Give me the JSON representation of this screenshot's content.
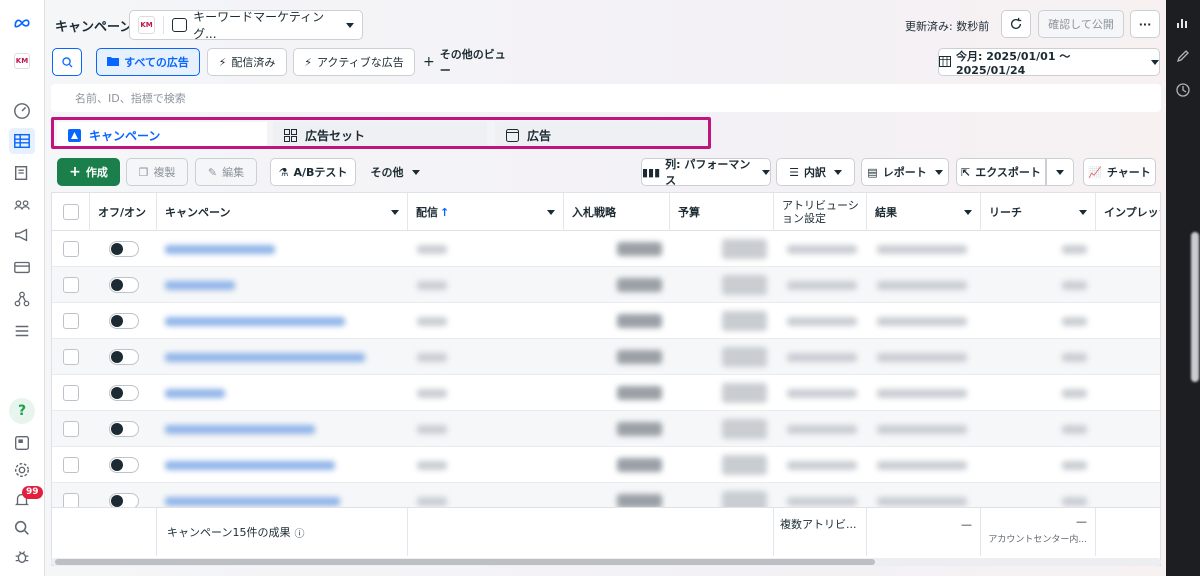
{
  "topbar": {
    "title": "キャンペーン",
    "account_name": "キーワードマーケティング...",
    "account_logo_text": "KM",
    "updated": "更新済み: 数秒前",
    "publish_label": "確認して公開",
    "more_label": "···"
  },
  "views": {
    "all_ads": "すべての広告",
    "delivered": "配信済み",
    "active_ads": "アクティブな広告",
    "other_views": "その他のビュー",
    "date_range": "今月: 2025/01/01 〜 2025/01/24"
  },
  "search": {
    "placeholder": "名前、ID、指標で検索"
  },
  "tabs": [
    {
      "label": "キャンペーン"
    },
    {
      "label": "広告セット"
    },
    {
      "label": "広告"
    }
  ],
  "actions": {
    "create": "作成",
    "duplicate": "複製",
    "edit": "編集",
    "ab_test": "A/Bテスト",
    "other": "その他",
    "columns": "列: パフォーマンス",
    "breakdown": "内訳",
    "report": "レポート",
    "export": "エクスポート",
    "chart": "チャート"
  },
  "table": {
    "headers": {
      "toggle": "オフ/オン",
      "campaign": "キャンペーン",
      "delivery": "配信",
      "bid": "入札戦略",
      "budget": "予算",
      "attribution": "アトリビューション設定",
      "results": "結果",
      "reach": "リーチ",
      "impressions": "インプレッション"
    },
    "footer": {
      "summary": "キャンペーン15件の成果",
      "attribution": "複数アトリビ...",
      "results": "—",
      "reach": "—",
      "reach_sub": "アカウントセンター内..."
    }
  },
  "badges": {
    "notifications": "99"
  },
  "colors": {
    "accent": "#0866ff",
    "create": "#1a7f4b",
    "highlight": "#c0147e"
  }
}
